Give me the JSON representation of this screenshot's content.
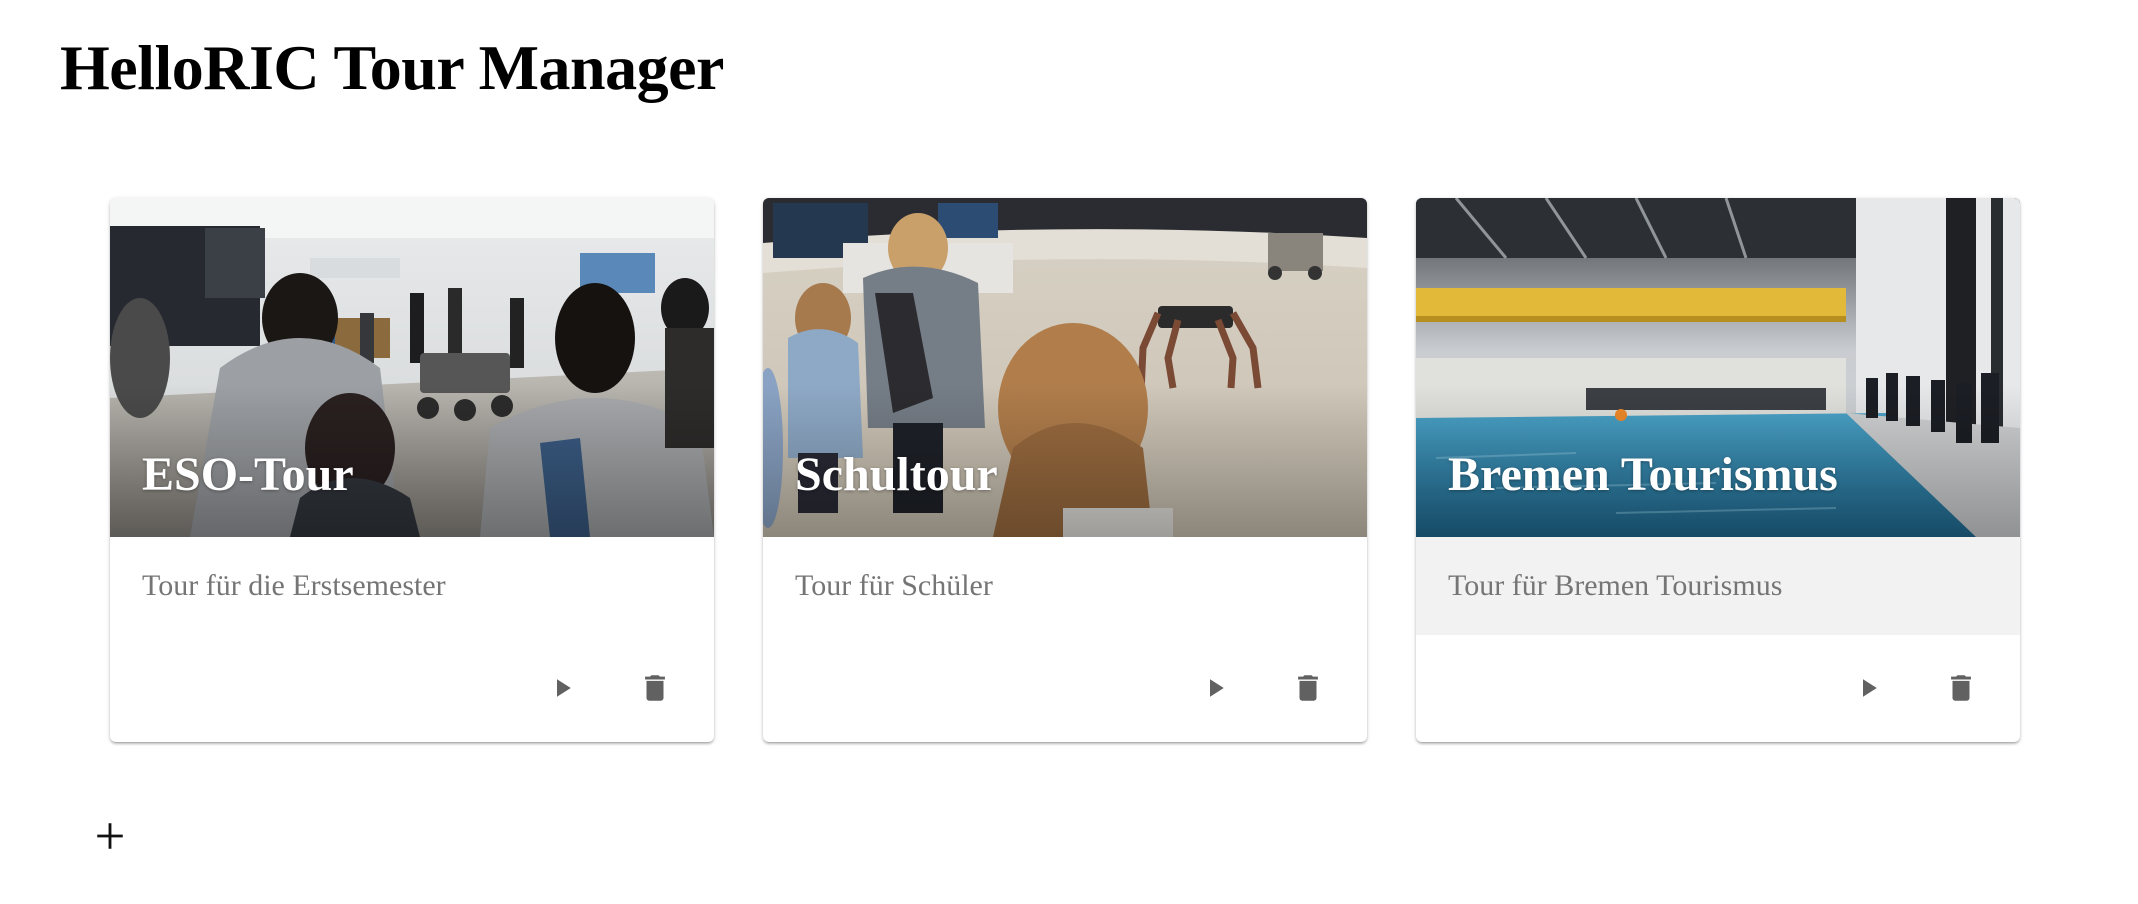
{
  "header": {
    "title": "HelloRIC Tour Manager"
  },
  "tours": [
    {
      "title": "ESO-Tour",
      "description": "Tour für die Erstsemester",
      "image": "students-watching-rover-demo-in-lab"
    },
    {
      "title": "Schultour",
      "description": "Tour für Schüler",
      "image": "children-watching-walking-robot-on-sand"
    },
    {
      "title": "Bremen Tourismus",
      "description": "Tour für Bremen Tourismus",
      "image": "visitors-at-indoor-water-test-basin"
    }
  ],
  "actions": {
    "play_icon": "play-icon",
    "delete_icon": "trash-icon",
    "add_icon": "plus-icon"
  },
  "colors": {
    "icon": "#616161",
    "description_text": "#757575",
    "hover_background": "#f2f2f2"
  }
}
